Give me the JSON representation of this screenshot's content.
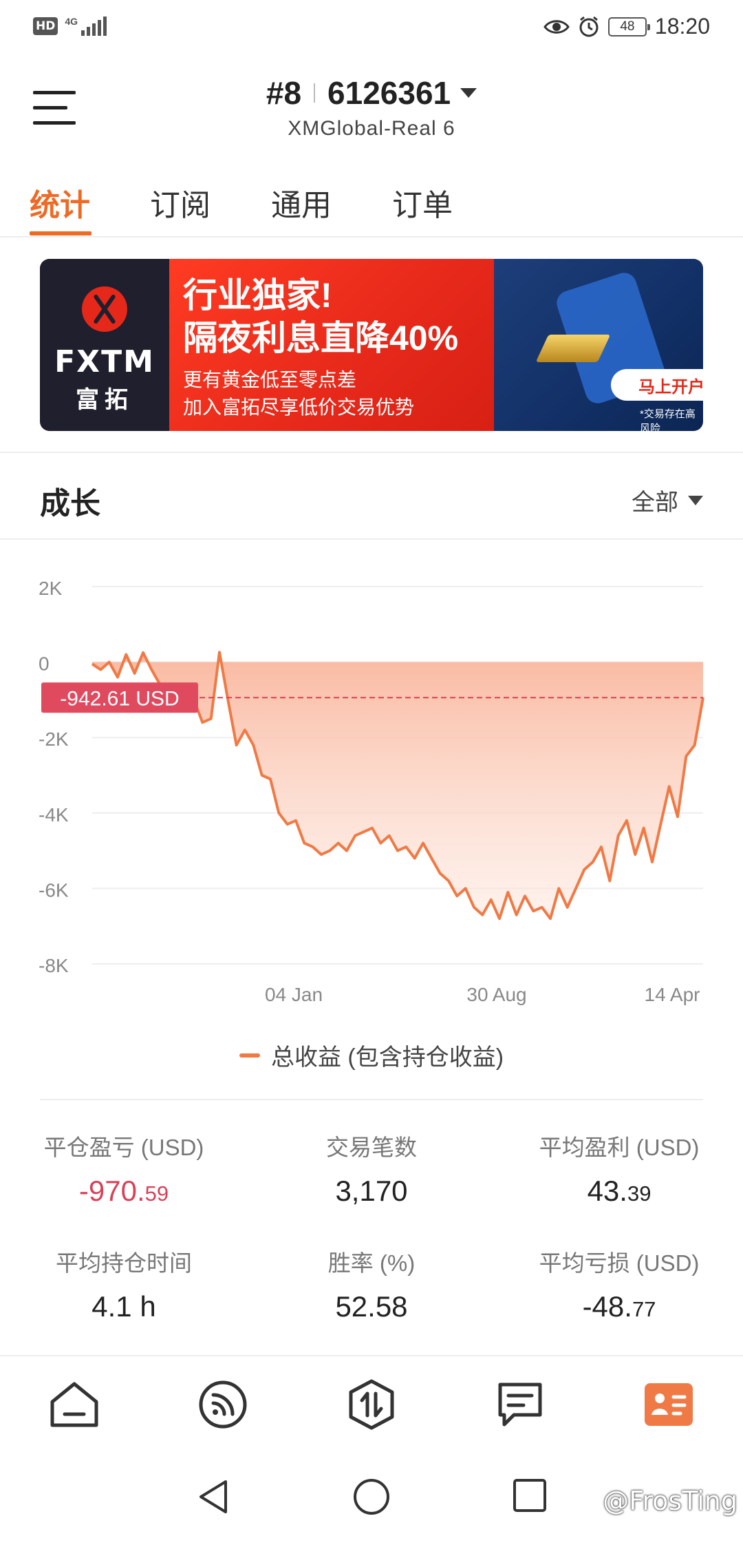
{
  "status_bar": {
    "hd_label": "HD",
    "network_label": "4G",
    "battery_level": "48",
    "time": "18:20",
    "icons": [
      "eye-icon",
      "alarm-icon",
      "battery-icon"
    ]
  },
  "header": {
    "account_prefix": "#8",
    "account_number": "6126361",
    "server": "XMGlobal-Real 6"
  },
  "tabs": [
    {
      "label": "统计",
      "active": true
    },
    {
      "label": "订阅",
      "active": false
    },
    {
      "label": "通用",
      "active": false
    },
    {
      "label": "订单",
      "active": false
    }
  ],
  "banner": {
    "brand": "FXTM",
    "brand_cn": "富拓",
    "headline_1": "行业独家!",
    "headline_2": "隔夜利息直降40%",
    "sub_1": "更有黄金低至零点差",
    "sub_2": "加入富拓尽享低价交易优势",
    "cta": "马上开户",
    "risk_note": "*交易存在高风险"
  },
  "growth": {
    "title": "成长",
    "filter_label": "全部"
  },
  "chart_data": {
    "type": "area",
    "title": "",
    "xlabel": "",
    "ylabel": "",
    "ylim": [
      -8000,
      2000
    ],
    "yticks": [
      "2K",
      "0",
      "-2K",
      "-4K",
      "-6K",
      "-8K"
    ],
    "xticks": [
      "04 Jan",
      "30 Aug",
      "14 Apr"
    ],
    "current_value_label": "-942.61 USD",
    "current_value": -942.61,
    "grid": true,
    "legend_position": "bottom",
    "series": [
      {
        "name": "总收益 (包含持仓收益)",
        "color": "#f07a46",
        "values": [
          -50,
          -200,
          0,
          -400,
          200,
          -300,
          250,
          -200,
          -600,
          -1100,
          -1000,
          -1200,
          -1000,
          -1600,
          -1500,
          260,
          -1000,
          -2200,
          -1800,
          -2200,
          -3000,
          -3100,
          -4000,
          -4300,
          -4200,
          -4800,
          -4900,
          -5100,
          -5000,
          -4800,
          -5000,
          -4600,
          -4500,
          -4400,
          -4800,
          -4600,
          -5000,
          -4900,
          -5200,
          -4800,
          -5200,
          -5600,
          -5800,
          -6200,
          -6000,
          -6500,
          -6700,
          -6300,
          -6800,
          -6100,
          -6700,
          -6200,
          -6600,
          -6500,
          -6800,
          -6000,
          -6500,
          -6000,
          -5500,
          -5300,
          -4900,
          -5800,
          -4600,
          -4200,
          -5100,
          -4400,
          -5300,
          -4300,
          -3300,
          -4100,
          -2500,
          -2200,
          -940
        ]
      }
    ]
  },
  "stats": [
    {
      "label": "平仓盈亏 (USD)",
      "int": "-970.",
      "dec": "59",
      "negative": true
    },
    {
      "label": "交易笔数",
      "int": "3,170",
      "dec": "",
      "negative": false
    },
    {
      "label": "平均盈利 (USD)",
      "int": "43.",
      "dec": "39",
      "negative": false
    },
    {
      "label": "平均持仓时间",
      "int": "4.1 h",
      "dec": "",
      "negative": false
    },
    {
      "label": "胜率 (%)",
      "int": "52.58",
      "dec": "",
      "negative": false
    },
    {
      "label": "平均亏损 (USD)",
      "int": "-48.",
      "dec": "77",
      "negative": false
    }
  ],
  "bottom_nav": [
    {
      "icon": "home-icon",
      "active": false
    },
    {
      "icon": "feed-icon",
      "active": false
    },
    {
      "icon": "trade-icon",
      "active": false
    },
    {
      "icon": "news-icon",
      "active": false
    },
    {
      "icon": "account-icon",
      "active": true
    }
  ],
  "system_nav": {
    "icons": [
      "back-icon",
      "home-circle-icon",
      "recents-icon"
    ],
    "watermark": "@FrosTing"
  },
  "colors": {
    "accent": "#ee6a25",
    "negative": "#d94159",
    "line": "#f07a46"
  }
}
